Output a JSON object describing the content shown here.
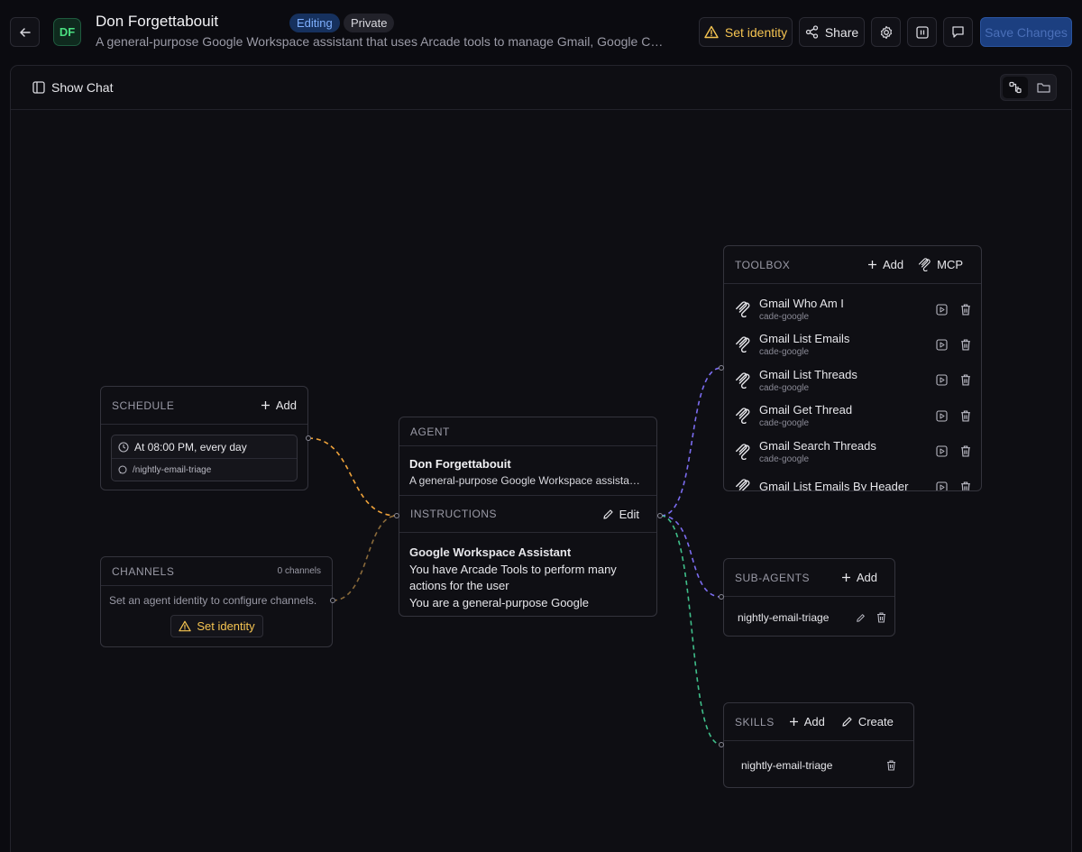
{
  "header": {
    "avatar_initials": "DF",
    "title": "Don Forgettabouit",
    "subtitle": "A general-purpose Google Workspace assistant that uses Arcade tools to manage Gmail, Google Calenda…",
    "badges": [
      "Editing",
      "Private"
    ],
    "set_identity_label": "Set identity",
    "share_label": "Share",
    "save_label": "Save Changes"
  },
  "panel": {
    "show_chat_label": "Show Chat"
  },
  "schedule": {
    "heading": "SCHEDULE",
    "add_label": "Add",
    "time": "At 08:00 PM, every day",
    "command": "/nightly-email-triage"
  },
  "channels": {
    "heading": "CHANNELS",
    "count": "0 channels",
    "message": "Set an agent identity to configure channels.",
    "set_identity_label": "Set identity"
  },
  "agent": {
    "heading": "AGENT",
    "name": "Don Forgettabouit",
    "description": "A general-purpose Google Workspace assista…",
    "instructions_heading": "INSTRUCTIONS",
    "edit_label": "Edit",
    "instr_title": "Google Workspace Assistant",
    "instr_line1": "You have Arcade Tools to perform many",
    "instr_line2": "actions for the user",
    "instr_line3": "You are a general-purpose Google"
  },
  "toolbox": {
    "heading": "TOOLBOX",
    "add_label": "Add",
    "mcp_label": "MCP",
    "tools": [
      {
        "name": "Gmail Who Am I",
        "source": "cade-google"
      },
      {
        "name": "Gmail List Emails",
        "source": "cade-google"
      },
      {
        "name": "Gmail List Threads",
        "source": "cade-google"
      },
      {
        "name": "Gmail Get Thread",
        "source": "cade-google"
      },
      {
        "name": "Gmail Search Threads",
        "source": "cade-google"
      },
      {
        "name": "Gmail List Emails By Header",
        "source": ""
      }
    ]
  },
  "subagents": {
    "heading": "SUB-AGENTS",
    "add_label": "Add",
    "item": "nightly-email-triage"
  },
  "skills": {
    "heading": "SKILLS",
    "add_label": "Add",
    "create_label": "Create",
    "item": "nightly-email-triage"
  },
  "colors": {
    "schedule_edge": "#f0a33a",
    "channels_edge": "#8a6a3a",
    "toolbox_edge": "#7b6cf0",
    "subagents_edge": "#7b6cf0",
    "skills_edge": "#3fbf8a",
    "warning": "#f5c451",
    "save_bg": "#1c3f80"
  }
}
